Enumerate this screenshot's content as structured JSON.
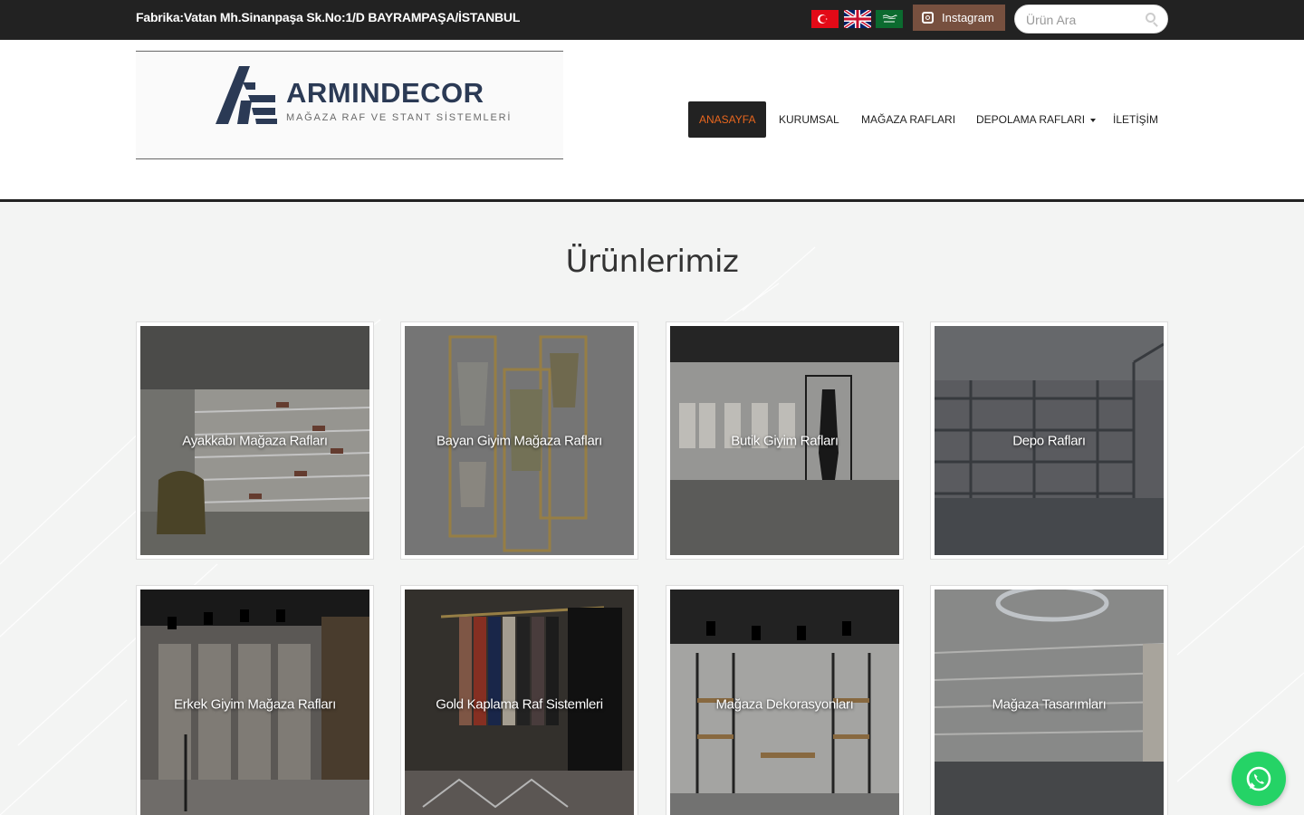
{
  "topbar": {
    "address": "Fabrika:Vatan Mh.Sinanpaşa Sk.No:1/D BAYRAMPAŞA/İSTANBUL",
    "flags": [
      {
        "name": "turkey-flag-icon",
        "color": "#e30a17"
      },
      {
        "name": "uk-flag-icon",
        "color": "#012169"
      },
      {
        "name": "saudi-flag-icon",
        "color": "#0b6b2f"
      }
    ],
    "instagram_label": "Instagram",
    "instagram_color": "#77503f",
    "search_placeholder": "Ürün Ara"
  },
  "header": {
    "logo_title": "ARMINDECOR",
    "logo_subtitle": "MAĞAZA RAF VE STANT SİSTEMLERİ",
    "brand_color": "#2b3a55"
  },
  "nav": {
    "items": [
      {
        "label": "ANASAYFA",
        "active": true
      },
      {
        "label": "KURUMSAL"
      },
      {
        "label": "MAĞAZA RAFLARI"
      },
      {
        "label": "DEPOLAMA RAFLARI",
        "dropdown": true
      },
      {
        "label": "İLETİŞİM"
      }
    ],
    "active_color": "#e8661e"
  },
  "main": {
    "title": "Ürünlerimiz",
    "products": [
      {
        "label": "Ayakkabı Mağaza Rafları"
      },
      {
        "label": "Bayan Giyim Mağaza Rafları"
      },
      {
        "label": "Butik Giyim Rafları"
      },
      {
        "label": "Depo Rafları"
      },
      {
        "label": "Erkek Giyim Mağaza Rafları"
      },
      {
        "label": "Gold Kaplama Raf Sistemleri"
      },
      {
        "label": "Mağaza Dekorasyonları"
      },
      {
        "label": "Mağaza Tasarımları"
      }
    ]
  },
  "whatsapp": {
    "color": "#25d366"
  }
}
